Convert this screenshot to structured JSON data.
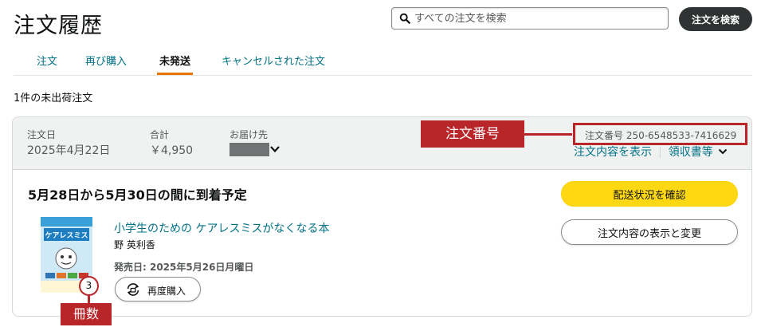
{
  "page": {
    "title": "注文履歴"
  },
  "search": {
    "placeholder": "すべての注文を検索",
    "button_label": "注文を検索"
  },
  "tabs": [
    {
      "label": "注文",
      "active": false
    },
    {
      "label": "再び購入",
      "active": false
    },
    {
      "label": "未発送",
      "active": true
    },
    {
      "label": "キャンセルされた注文",
      "active": false
    }
  ],
  "summary": "1件の未出荷注文",
  "order": {
    "date_label": "注文日",
    "date_value": "2025年4月22日",
    "total_label": "合計",
    "total_value": "￥4,950",
    "ship_to_label": "お届け先",
    "order_number": "注文番号 250-6548533-7416629",
    "links": {
      "view_details": "注文内容を表示",
      "receipt": "領収書等"
    },
    "delivery_heading": "5月28日から5月30日の間に到着予定",
    "track_button": "配送状況を確認",
    "view_edit_button": "注文内容の表示と変更",
    "item": {
      "title": "小学生のための ケアレスミスがなくなる本",
      "author": "野 英利香",
      "release": "発売日: 2025年5月26日月曜日",
      "rebuy_button": "再度購入",
      "cover_text": "ケアレスミス",
      "quantity": "3"
    }
  },
  "annotations": {
    "order_number_label": "注文番号",
    "quantity_label": "冊数",
    "color": "#b8262a"
  },
  "colors": {
    "link": "#007185",
    "accent_tab": "#e77600",
    "track_button": "#ffd814",
    "search_button": "#303333"
  }
}
